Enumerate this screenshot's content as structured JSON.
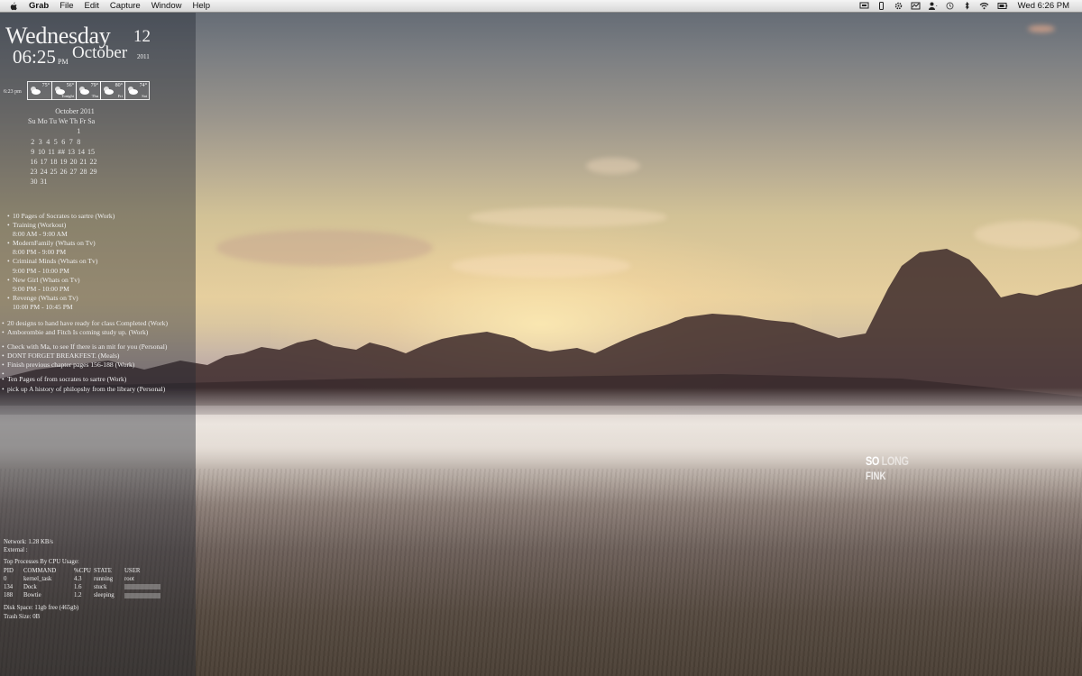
{
  "menubar": {
    "app_name": "Grab",
    "menus": [
      "File",
      "Edit",
      "Capture",
      "Window",
      "Help"
    ],
    "clock": "Wed 6:26 PM"
  },
  "widget": {
    "weekday": "Wednesday",
    "day": "12",
    "time": "06:25",
    "ampm": "PM",
    "month": "October",
    "year": "2011"
  },
  "weather": {
    "current_time": "6:23 pm",
    "days": [
      {
        "temp": "75°",
        "label": "",
        "icon": "partly-cloudy-icon"
      },
      {
        "temp": "56°",
        "label": "Tonight",
        "icon": "partly-cloudy-icon"
      },
      {
        "temp": "79°",
        "label": "Thu",
        "icon": "partly-cloudy-icon"
      },
      {
        "temp": "80°",
        "label": "Fri",
        "icon": "partly-cloudy-icon"
      },
      {
        "temp": "74°",
        "label": "Sat",
        "icon": "partly-cloudy-icon"
      }
    ]
  },
  "calendar": {
    "title": "October 2011",
    "header": "Su Mo Tu We Th Fr Sa",
    "weeks": [
      [
        "",
        "",
        "",
        "",
        "",
        "",
        "1"
      ],
      [
        "2",
        "3",
        "4",
        "5",
        "6",
        "7",
        "8"
      ],
      [
        "9",
        "10",
        "11",
        "##",
        "13",
        "14",
        "15"
      ],
      [
        "16",
        "17",
        "18",
        "19",
        "20",
        "21",
        "22"
      ],
      [
        "23",
        "24",
        "25",
        "26",
        "27",
        "28",
        "29"
      ],
      [
        "30",
        "31",
        "",
        "",
        "",
        "",
        ""
      ]
    ]
  },
  "events": [
    {
      "title": "10 Pages of Socrates to sartre (Work)",
      "time": ""
    },
    {
      "title": "Training (Workout)",
      "time": "8:00 AM - 9:00 AM"
    },
    {
      "title": "ModernFamily (Whats on Tv)",
      "time": "8:00 PM - 9:00 PM"
    },
    {
      "title": "Criminal Minds (Whats on Tv)",
      "time": "9:00 PM - 10:00 PM"
    },
    {
      "title": "New Girl (Whats on Tv)",
      "time": "9:00 PM - 10:00 PM"
    },
    {
      "title": "Revenge (Whats on Tv)",
      "time": "10:00 PM - 10:45 PM"
    }
  ],
  "todos_group1": [
    "20 designs to hand have ready for class Completed (Work)",
    "Amborombie and Fitch Is coming study up. (Work)"
  ],
  "todos_group2": [
    "Check with Ma, to see If there is an mit for you (Personal)",
    "DONT FORGET BREAKFEST. (Meals)",
    "Finish previous chapter pages 156-188 (Work)",
    ""
  ],
  "todos_group3": [
    "Ten Pages of from socrates to sartre (Work)",
    "pick up A history of philopshy from the library (Personal)"
  ],
  "sysinfo": {
    "network": "Network: 1.28 KB/s",
    "external": "External :",
    "top_title": "Top Processes By CPU Usage:",
    "columns": [
      "PID",
      "COMMAND",
      "%CPU",
      "STATE",
      "USER"
    ],
    "processes": [
      {
        "pid": "0",
        "command": "kernel_task",
        "cpu": "4.3",
        "state": "running",
        "user": "root"
      },
      {
        "pid": "134",
        "command": "Dock",
        "cpu": "1.6",
        "state": "stuck",
        "user": ""
      },
      {
        "pid": "188",
        "command": "Bowtie",
        "cpu": "1.2",
        "state": "sleeping",
        "user": ""
      }
    ],
    "disk": "Disk Space: 11gb free (465gb)",
    "trash": "Trash Size: 0B"
  },
  "desktop_text": {
    "so": "SO",
    "long": "LONG",
    "fink": "FINK"
  }
}
